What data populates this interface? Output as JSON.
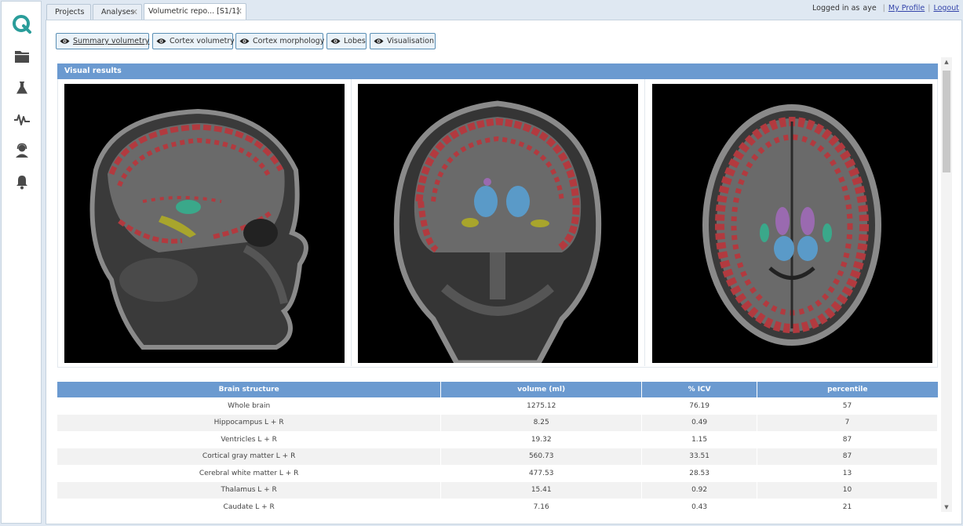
{
  "sidebar": {
    "items": [
      {
        "icon": "logo-q-icon",
        "color": "#2a9d9a"
      },
      {
        "icon": "folder-icon"
      },
      {
        "icon": "flask-icon"
      },
      {
        "icon": "pulse-icon"
      },
      {
        "icon": "user-support-icon"
      },
      {
        "icon": "bell-icon"
      }
    ]
  },
  "tabs": [
    {
      "label": "Projects",
      "closable": false
    },
    {
      "label": "Analyses",
      "closable": true
    },
    {
      "label": "Volumetric repo... [S1/1]",
      "closable": true,
      "active": true
    }
  ],
  "user": {
    "logged_in_as": "Logged in as",
    "username": "aye",
    "profile": "My Profile",
    "logout": "Logout",
    "separator": "|"
  },
  "view_buttons": [
    {
      "label": "Summary volumetry",
      "active": true
    },
    {
      "label": "Cortex volumetry"
    },
    {
      "label": "Cortex morphology"
    },
    {
      "label": "Lobes"
    },
    {
      "label": "Visualisation"
    }
  ],
  "visual_results": {
    "title": "Visual results",
    "views": [
      "sagittal-mri-view",
      "coronal-mri-view",
      "axial-mri-view"
    ]
  },
  "table": {
    "headers": [
      "Brain structure",
      "volume (ml)",
      "% ICV",
      "percentile"
    ],
    "rows": [
      [
        "Whole brain",
        "1275.12",
        "76.19",
        "57"
      ],
      [
        "Hippocampus L + R",
        "8.25",
        "0.49",
        "7"
      ],
      [
        "Ventricles L + R",
        "19.32",
        "1.15",
        "87"
      ],
      [
        "Cortical gray matter L + R",
        "560.73",
        "33.51",
        "87"
      ],
      [
        "Cerebral white matter L + R",
        "477.53",
        "28.53",
        "13"
      ],
      [
        "Thalamus L + R",
        "15.41",
        "0.92",
        "10"
      ],
      [
        "Caudate L + R",
        "7.16",
        "0.43",
        "21"
      ]
    ]
  },
  "colors": {
    "accent": "#6b9ad0",
    "cortex": "#b23a3f",
    "ventricles": "#5a9ac8",
    "hippocampus": "#a8a52c",
    "thalamus": "#3aa88a",
    "caudate": "#9a6ab0"
  }
}
